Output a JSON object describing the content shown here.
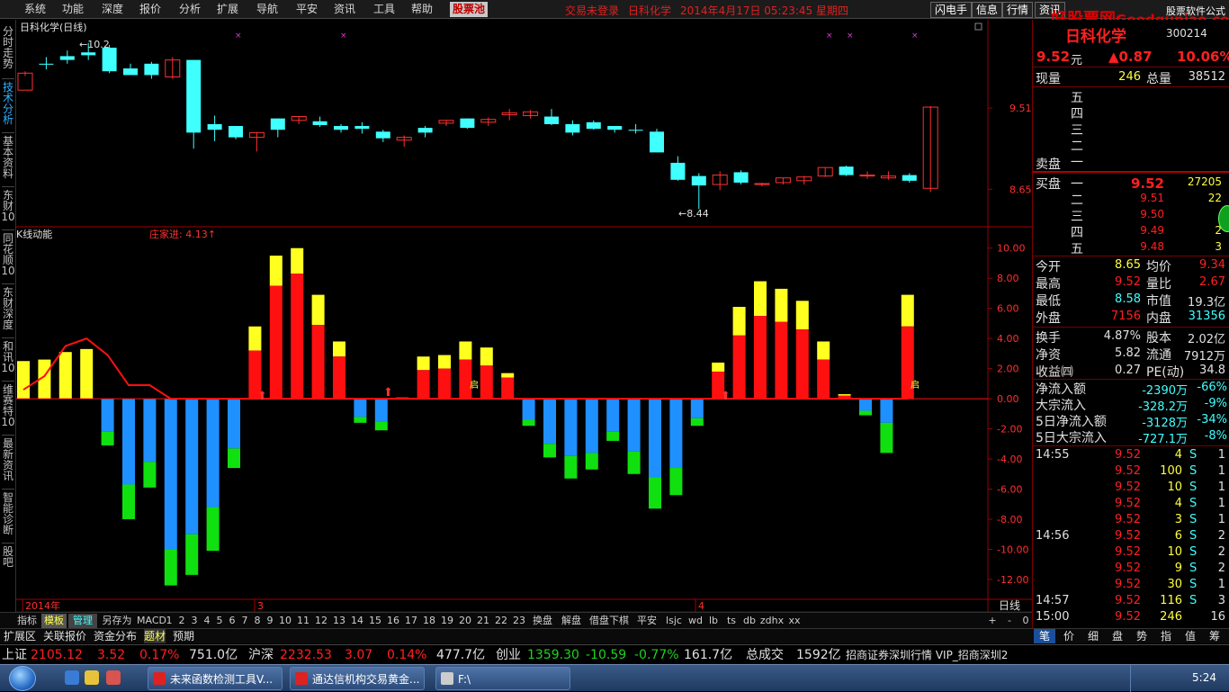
{
  "menu": {
    "items": [
      "系统",
      "功能",
      "深度",
      "报价",
      "分析",
      "扩展",
      "导航",
      "平安",
      "资讯",
      "工具",
      "帮助"
    ],
    "active": "股票池",
    "status": [
      "交易未登录",
      "日科化学",
      "2014年4月17日 05:23:45 星期四"
    ],
    "right_buttons": [
      "闪电手",
      "信息",
      "行情",
      "资讯"
    ],
    "corner_label": "股票软件公式"
  },
  "watermark": {
    "text": "好股票网",
    "site": "Goodgupiao.com"
  },
  "left_tabs": [
    "分时走势",
    "技术分析",
    "基本资料",
    "东财10",
    "同花顺10",
    "东财深度",
    "和讯10",
    "维赛特10",
    "最新资讯",
    "智能诊断",
    "股吧"
  ],
  "left_tabs_active": 1,
  "chart_top": {
    "title": "日科化学(日线)",
    "high_label": "10.2",
    "low_label": "8.44",
    "y_ticks": [
      "9.51",
      "8.65"
    ]
  },
  "chart_bottom": {
    "title": "K线动能",
    "indicator_label": "庄家进: 4.13",
    "qi_label": "启"
  },
  "chart_data": {
    "type": "bar",
    "top_candles": [
      [
        9.7,
        9.9,
        9.85,
        9.88
      ],
      [
        9.98,
        10.05,
        9.92,
        9.97
      ],
      [
        10.06,
        10.12,
        9.98,
        10.02
      ],
      [
        10.1,
        10.2,
        10.02,
        10.07
      ],
      [
        10.15,
        10.18,
        9.88,
        9.9
      ],
      [
        9.93,
        9.98,
        9.86,
        9.86
      ],
      [
        9.98,
        10.0,
        9.82,
        9.86
      ],
      [
        9.84,
        10.05,
        9.82,
        10.02
      ],
      [
        10.02,
        10.02,
        9.08,
        9.25
      ],
      [
        9.34,
        9.43,
        9.16,
        9.28
      ],
      [
        9.32,
        9.32,
        9.18,
        9.2
      ],
      [
        9.2,
        9.25,
        9.05,
        9.25
      ],
      [
        9.4,
        9.4,
        9.2,
        9.28
      ],
      [
        9.38,
        9.42,
        9.34,
        9.42
      ],
      [
        9.37,
        9.42,
        9.31,
        9.33
      ],
      [
        9.32,
        9.34,
        9.25,
        9.28
      ],
      [
        9.32,
        9.36,
        9.24,
        9.29
      ],
      [
        9.26,
        9.28,
        9.15,
        9.19
      ],
      [
        9.17,
        9.22,
        9.1,
        9.2
      ],
      [
        9.3,
        9.32,
        9.2,
        9.25
      ],
      [
        9.35,
        9.38,
        9.32,
        9.38
      ],
      [
        9.4,
        9.4,
        9.29,
        9.3
      ],
      [
        9.36,
        9.41,
        9.32,
        9.39
      ],
      [
        9.44,
        9.5,
        9.38,
        9.46
      ],
      [
        9.43,
        9.49,
        9.4,
        9.47
      ],
      [
        9.42,
        9.5,
        9.33,
        9.34
      ],
      [
        9.34,
        9.38,
        9.22,
        9.25
      ],
      [
        9.36,
        9.38,
        9.28,
        9.29
      ],
      [
        9.32,
        9.32,
        9.25,
        9.28
      ],
      [
        9.28,
        9.34,
        9.24,
        9.27
      ],
      [
        9.26,
        9.29,
        9.04,
        9.04
      ],
      [
        8.93,
        9.0,
        8.74,
        8.75
      ],
      [
        8.79,
        8.82,
        8.44,
        8.69
      ],
      [
        8.7,
        8.84,
        8.64,
        8.8
      ],
      [
        8.83,
        8.85,
        8.7,
        8.72
      ],
      [
        8.7,
        8.72,
        8.68,
        8.71
      ],
      [
        8.72,
        8.77,
        8.7,
        8.77
      ],
      [
        8.74,
        8.79,
        8.7,
        8.78
      ],
      [
        8.79,
        8.88,
        8.78,
        8.88
      ],
      [
        8.89,
        8.9,
        8.79,
        8.8
      ],
      [
        8.8,
        8.84,
        8.76,
        8.8
      ],
      [
        8.77,
        8.84,
        8.75,
        8.79
      ],
      [
        8.8,
        8.82,
        8.72,
        8.74
      ],
      [
        8.66,
        9.53,
        8.62,
        9.52
      ]
    ],
    "bars": [
      [
        2.5,
        0,
        0,
        0
      ],
      [
        2.6,
        0,
        0,
        0
      ],
      [
        3.1,
        0,
        0,
        0
      ],
      [
        3.3,
        0,
        0,
        0
      ],
      [
        0,
        0,
        -2.2,
        -3.1
      ],
      [
        0,
        0,
        -5.7,
        -8.0
      ],
      [
        0,
        0,
        -4.2,
        -5.9
      ],
      [
        0,
        0,
        -10.0,
        -12.4
      ],
      [
        0,
        0,
        -9.0,
        -11.7
      ],
      [
        0,
        0,
        -7.2,
        -10.1
      ],
      [
        0,
        0,
        -3.3,
        -4.6
      ],
      [
        4.8,
        3.2,
        0,
        0
      ],
      [
        9.5,
        7.5,
        0,
        0
      ],
      [
        10.0,
        8.3,
        0,
        0
      ],
      [
        6.9,
        4.9,
        0,
        0
      ],
      [
        3.8,
        2.8,
        0,
        0
      ],
      [
        0,
        0,
        -1.2,
        -1.6
      ],
      [
        0,
        0,
        -1.5,
        -2.1
      ],
      [
        0.1,
        0.1,
        0,
        0
      ],
      [
        2.8,
        1.9,
        0,
        0
      ],
      [
        2.9,
        2.0,
        0,
        0
      ],
      [
        3.8,
        2.6,
        0,
        0
      ],
      [
        3.4,
        2.2,
        0,
        0
      ],
      [
        1.7,
        1.4,
        0,
        0
      ],
      [
        0,
        0,
        -1.4,
        -1.8
      ],
      [
        0,
        0,
        -3.0,
        -3.9
      ],
      [
        0,
        0,
        -3.8,
        -5.3
      ],
      [
        0,
        0,
        -3.6,
        -4.7
      ],
      [
        0,
        0,
        -2.2,
        -2.8
      ],
      [
        0,
        0,
        -3.5,
        -5.0
      ],
      [
        0,
        0,
        -5.2,
        -7.3
      ],
      [
        0,
        0,
        -4.6,
        -6.4
      ],
      [
        0,
        0,
        -1.3,
        -1.8
      ],
      [
        2.4,
        1.8,
        0,
        0
      ],
      [
        6.1,
        4.2,
        0,
        0
      ],
      [
        7.8,
        5.5,
        0,
        0
      ],
      [
        7.3,
        5.1,
        0,
        0
      ],
      [
        6.5,
        4.6,
        0,
        0
      ],
      [
        3.8,
        2.6,
        0,
        0
      ],
      [
        0.3,
        0.2,
        0,
        0
      ],
      [
        0,
        0,
        -0.8,
        -1.1
      ],
      [
        0,
        0,
        -1.6,
        -3.6
      ],
      [
        6.9,
        4.8,
        0,
        0
      ]
    ],
    "line": [
      0.6,
      1.5,
      3.5,
      4.0,
      2.9,
      0.9,
      0.9,
      0,
      0,
      0,
      0,
      0,
      0,
      0,
      0,
      0,
      0,
      0,
      0,
      0,
      0,
      0,
      0,
      0,
      0,
      0,
      0,
      0,
      0,
      0,
      0,
      0,
      0,
      0,
      0,
      0,
      0,
      0,
      0,
      0,
      0,
      0,
      0
    ],
    "y_ticks": [
      "10.00",
      "8.00",
      "6.00",
      "4.00",
      "2.00",
      "0.00",
      "-2.00",
      "-4.00",
      "-6.00",
      "-8.00",
      "-10.00",
      "-12.00"
    ],
    "x_ticks": [
      "2014年",
      "3",
      "4"
    ],
    "right_label": "日线",
    "top_ylim": [
      8.3,
      10.35
    ],
    "bottom_ylim": [
      -13.5,
      11.0
    ]
  },
  "right": {
    "header": {
      "name": "日科化学",
      "code": "300214",
      "price": "9.52",
      "unit": "元",
      "change": "▲0.87",
      "pct": "10.06%"
    },
    "vol_row": {
      "l1": "现量",
      "v1": "246",
      "l2": "总量",
      "v2": "38512"
    },
    "sell_label": "卖盘",
    "sell_levels": [
      "五",
      "四",
      "三",
      "二",
      "一"
    ],
    "buy_label": "买盘",
    "buy_rows": [
      {
        "lvl": "一",
        "price": "9.52",
        "vol": "27205"
      },
      {
        "lvl": "二",
        "price": "9.51",
        "vol": "22"
      },
      {
        "lvl": "三",
        "price": "9.50",
        "vol": ""
      },
      {
        "lvl": "四",
        "price": "9.49",
        "vol": "2"
      },
      {
        "lvl": "五",
        "price": "9.48",
        "vol": "3"
      }
    ],
    "stats": [
      {
        "l1": "今开",
        "v1": "8.65",
        "c1": "yel",
        "l2": "均价",
        "v2": "9.34",
        "c2": "red"
      },
      {
        "l1": "最高",
        "v1": "9.52",
        "c1": "red",
        "l2": "量比",
        "v2": "2.67",
        "c2": "red"
      },
      {
        "l1": "最低",
        "v1": "8.58",
        "c1": "cya",
        "l2": "市值",
        "v2": "19.3亿",
        "c2": "wht"
      },
      {
        "l1": "外盘",
        "v1": "7156",
        "c1": "red",
        "l2": "内盘",
        "v2": "31356",
        "c2": "cya"
      }
    ],
    "stats2": [
      {
        "l1": "换手",
        "v1": "4.87%",
        "l2": "股本",
        "v2": "2.02亿"
      },
      {
        "l1": "净资",
        "v1": "5.82",
        "l2": "流通",
        "v2": "7912万"
      },
      {
        "l1": "收益㈣",
        "v1": "0.27",
        "l2": "PE(动)",
        "v2": "34.8"
      }
    ],
    "flows": [
      {
        "l": "净流入额",
        "v1": "-2390万",
        "v2": "-66%"
      },
      {
        "l": "大宗流入",
        "v1": "-328.2万",
        "v2": "-9%"
      },
      {
        "l": "5日净流入额",
        "v1": "-3128万",
        "v2": "-34%"
      },
      {
        "l": "5日大宗流入",
        "v1": "-727.1万",
        "v2": "-8%"
      }
    ],
    "ticks": [
      {
        "t": "14:55",
        "p": "9.52",
        "v": "4",
        "s": "S",
        "n": "1"
      },
      {
        "t": "",
        "p": "9.52",
        "v": "100",
        "s": "S",
        "n": "1"
      },
      {
        "t": "",
        "p": "9.52",
        "v": "10",
        "s": "S",
        "n": "1"
      },
      {
        "t": "",
        "p": "9.52",
        "v": "4",
        "s": "S",
        "n": "1"
      },
      {
        "t": "",
        "p": "9.52",
        "v": "3",
        "s": "S",
        "n": "1"
      },
      {
        "t": "14:56",
        "p": "9.52",
        "v": "6",
        "s": "S",
        "n": "2"
      },
      {
        "t": "",
        "p": "9.52",
        "v": "10",
        "s": "S",
        "n": "2"
      },
      {
        "t": "",
        "p": "9.52",
        "v": "9",
        "s": "S",
        "n": "2"
      },
      {
        "t": "",
        "p": "9.52",
        "v": "30",
        "s": "S",
        "n": "1"
      },
      {
        "t": "14:57",
        "p": "9.52",
        "v": "116",
        "s": "S",
        "n": "3"
      },
      {
        "t": "15:00",
        "p": "9.52",
        "v": "246",
        "s": "",
        "n": "16"
      }
    ],
    "tabs": [
      "笔",
      "价",
      "细",
      "盘",
      "势",
      "指",
      "值",
      "筹"
    ]
  },
  "index_tabs": [
    "指标",
    "模板",
    "管理",
    "另存为",
    "MACD",
    "1",
    "2",
    "3",
    "4",
    "5",
    "6",
    "7",
    "8",
    "9",
    "10",
    "11",
    "12",
    "13",
    "14",
    "15",
    "16",
    "17",
    "18",
    "19",
    "20",
    "21",
    "22",
    "23",
    "换盘",
    "解盘",
    "借盘下棋",
    "平安",
    "lsjc",
    "wd",
    "lb",
    "ts",
    "db",
    "zdhx",
    "xx"
  ],
  "index_controls": [
    "+",
    "-",
    "0"
  ],
  "row2_tabs": [
    "扩展区",
    "关联报价",
    "资金分布",
    "题材",
    "预期"
  ],
  "market": {
    "sh": {
      "label": "上证",
      "val": "2105.12",
      "chg": "3.52",
      "pct": "0.17%",
      "amt": "751.0亿"
    },
    "sz": {
      "label": "沪深",
      "val": "2232.53",
      "chg": "3.07",
      "pct": "0.14%",
      "amt": "477.7亿"
    },
    "cy": {
      "label": "创业",
      "val": "1359.30",
      "chg": "-10.59",
      "pct": "-0.77%",
      "amt": "161.7亿"
    },
    "total": {
      "label": "总成交",
      "amt": "1592亿"
    },
    "broker": "招商证券深圳行情 VIP_招商深圳2"
  },
  "taskbar": {
    "tasks": [
      "未来函数检测工具V...",
      "通达信机构交易黄金...",
      "F:\\"
    ],
    "clock": "5:24"
  }
}
